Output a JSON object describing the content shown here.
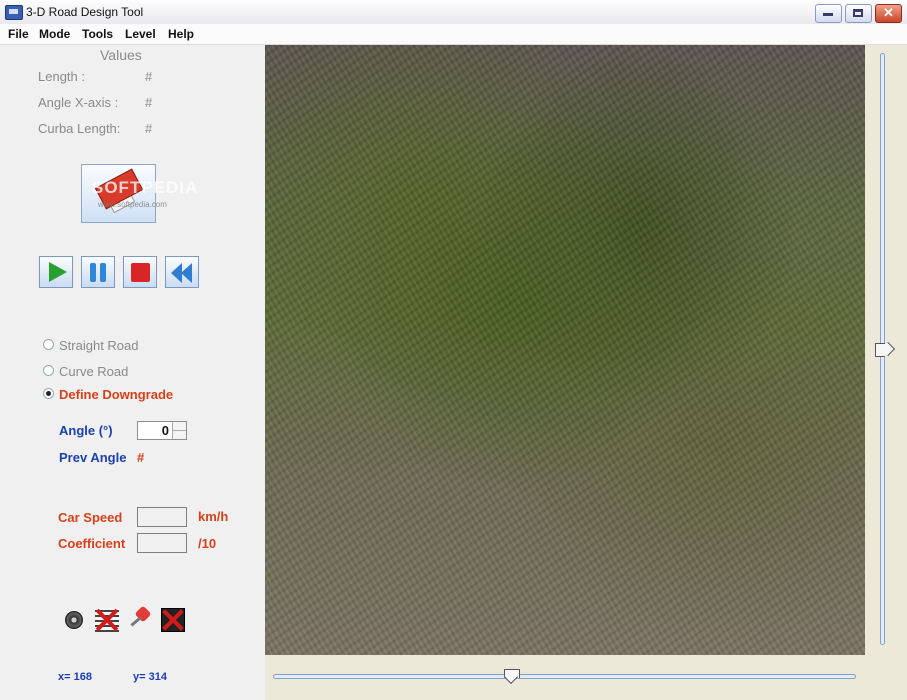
{
  "window": {
    "title": "3-D Road Design Tool"
  },
  "menu": [
    "File",
    "Mode",
    "Tools",
    "Level",
    "Help"
  ],
  "values": {
    "title": "Values",
    "length_label": "Length :",
    "length_value": "#",
    "angle_label": "Angle X-axis :",
    "angle_value": "#",
    "curba_label": "Curba Length:",
    "curba_value": "#"
  },
  "watermark": {
    "main": "SOFTPEDIA",
    "sub": "www.softpedia.com"
  },
  "road_modes": [
    {
      "label": "Straight Road",
      "checked": false
    },
    {
      "label": "Curve Road",
      "checked": false
    },
    {
      "label": "Define Downgrade",
      "checked": true
    }
  ],
  "downgrade": {
    "angle_label": "Angle (°)",
    "angle_value": "0",
    "prev_angle_label": "Prev Angle",
    "prev_angle_value": "#"
  },
  "car": {
    "speed_label": "Car Speed",
    "speed_value": "",
    "speed_unit": "km/h",
    "coef_label": "Coefficient",
    "coef_value": "",
    "coef_unit": "/10"
  },
  "coords": {
    "x": "x= 168",
    "y": "y= 314"
  },
  "sliders": {
    "vertical_fraction": 0.5,
    "horizontal_fraction": 0.4
  }
}
